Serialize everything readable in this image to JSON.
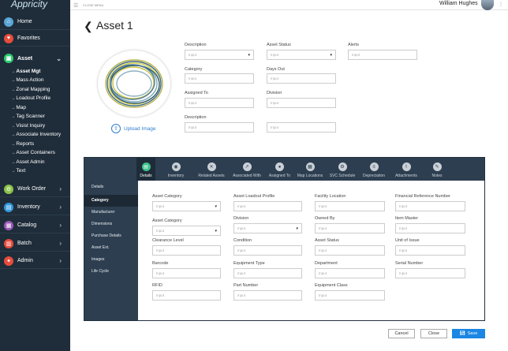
{
  "app": {
    "logo_text": "Appricity"
  },
  "topbar": {
    "close_menu": "CLOSE MENU",
    "user_name": "William Hughes"
  },
  "sidebar": {
    "items": [
      {
        "label": "Home",
        "icon": "home-icon",
        "color": "#5aa7d6"
      },
      {
        "label": "Favorites",
        "icon": "heart-icon",
        "color": "#e74c3c"
      },
      {
        "label": "Asset",
        "icon": "asset-icon",
        "color": "#2ecc71"
      },
      {
        "label": "Work Order",
        "icon": "work-order-icon",
        "color": "#8bc34a"
      },
      {
        "label": "Inventory",
        "icon": "inventory-icon",
        "color": "#3498db"
      },
      {
        "label": "Catalog",
        "icon": "catalog-icon",
        "color": "#9b59b6"
      },
      {
        "label": "Batch",
        "icon": "batch-icon",
        "color": "#e74c3c"
      },
      {
        "label": "Admin",
        "icon": "admin-icon",
        "color": "#e74c3c"
      }
    ],
    "asset_sub": [
      "Asset Mgt",
      "Mass Action",
      "Zonal Mapping",
      "Loadout Profile",
      "Map",
      "Tag Scanner",
      "Visist Inquiry",
      "Associate Inventory",
      "Reports",
      "Asset Containers",
      "Asset Admin",
      "Text"
    ]
  },
  "page": {
    "back_icon": "back-arrow-icon",
    "title": "Asset 1",
    "upload_label": "Upload Image"
  },
  "top_form": {
    "description_label": "Description",
    "description_placeholder": "Input",
    "asset_status_label": "Asset Status",
    "asset_status_placeholder": "Input",
    "alerts_label": "Alerts",
    "alerts_placeholder": "Input",
    "category_label": "Category",
    "category_placeholder": "Input",
    "days_out_label": "Days Out",
    "days_out_placeholder": "Input",
    "assigned_to_label": "Assigned To",
    "assigned_to_placeholder": "Input",
    "division_label": "Division",
    "division_placeholder": "Input",
    "description2_label": "Description",
    "description2_placeholder": "Input",
    "extra_placeholder": "Input"
  },
  "tabs": [
    "Details",
    "Inventory",
    "Related Assets",
    "Associated With",
    "Assigned To",
    "Map Locations",
    "SVC Schedule",
    "Depreciation",
    "Attachments",
    "Notes"
  ],
  "left_nav": [
    "Details",
    "Category",
    "Manufacturer",
    "Dimensions",
    "Purchase Details",
    "Asset Ext.",
    "Images",
    "Life Cycle"
  ],
  "detail_form": {
    "asset_category1": "Asset Category",
    "asset_loadout_profile": "Asset Loadout Profile",
    "facility_location": "Facility Location",
    "financial_reference_number": "Financial Reference Number",
    "asset_category2": "Asset Category",
    "division": "Division",
    "owned_by": "Owned By",
    "item_master": "Item Master",
    "clearance_level": "Clearance Level",
    "condition": "Condition",
    "asset_status": "Asset Status",
    "unit_of_issue": "Unit of Issue",
    "barcode": "Barcode",
    "equipment_type": "Equipment Type",
    "department": "Department",
    "serial_number": "Serial Number",
    "rfid": "RFID",
    "part_number": "Part Number",
    "equipment_class": "Equipment Class",
    "placeholder": "Input"
  },
  "footer": {
    "cancel": "Cancel",
    "close": "Close",
    "save": "Save"
  },
  "colors": {
    "sidebar_bg": "#1f2d3a",
    "panel_bg": "#2d3e50",
    "primary": "#1b86e3",
    "active_tab_icon": "#3cc38a"
  }
}
